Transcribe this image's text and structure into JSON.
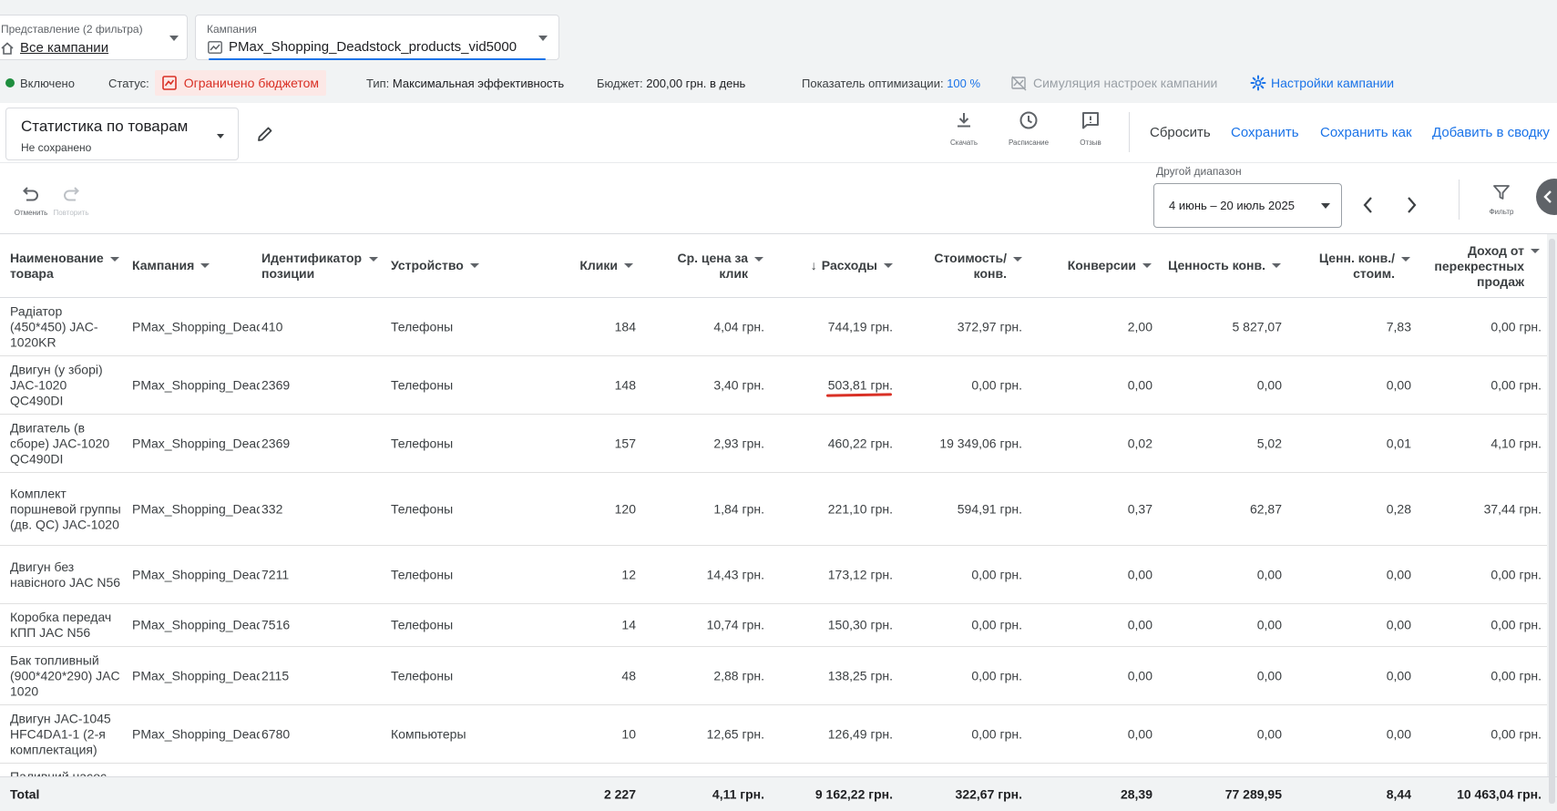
{
  "filters": {
    "view": {
      "label": "Представление (2 фильтра)",
      "value": "Все кампании",
      "icon": "home-icon"
    },
    "campaign": {
      "label": "Кампания",
      "value": "PMax_Shopping_Deadstock_products_vid5000",
      "icon": "trend-icon"
    }
  },
  "status_bar": {
    "enabled": "Включено",
    "status_label": "Статус:",
    "status_value": "Ограничено бюджетом",
    "type_label": "Тип:",
    "type_value": "Максимальная эффективность",
    "budget_label": "Бюджет:",
    "budget_value": "200,00 грн. в день",
    "optimization_label": "Показатель оптимизации:",
    "optimization_value": "100 %",
    "simulation": "Симуляция настроек кампании",
    "settings": "Настройки кампании"
  },
  "report": {
    "title": "Статистика по товарам",
    "subtitle": "Не сохранено"
  },
  "toolbar": {
    "download": "Скачать",
    "schedule": "Расписание",
    "feedback": "Отзыв",
    "reset": "Сбросить",
    "save": "Сохранить",
    "save_as": "Сохранить как",
    "add_to_summary": "Добавить в сводку"
  },
  "history": {
    "undo": "Отменить",
    "redo": "Повторить"
  },
  "date_range": {
    "label": "Другой диапазон",
    "value": "4 июнь – 20 июль 2025"
  },
  "filter_label": "Фильтр",
  "table": {
    "columns": {
      "name": "Наименование товара",
      "campaign": "Кампания",
      "item_id": "Идентификатор позиции",
      "device": "Устройство",
      "clicks": "Клики",
      "avg_cpc": "Ср. цена за клик",
      "cost": "Расходы",
      "cost_conv": "Стоимость/ конв.",
      "conversions": "Конверсии",
      "conv_value": "Ценность конв.",
      "value_cost": "Ценн. конв./ стоим.",
      "cross_sell": "Доход от перекрестных продаж"
    },
    "rows": [
      {
        "name": "Радіатор (450*450) JAC-1020KR",
        "campaign": "PMax_Shopping_Deadstock",
        "item_id": "410",
        "device": "Телефоны",
        "clicks": "184",
        "avg_cpc": "4,04 грн.",
        "cost": "744,19 грн.",
        "cost_conv": "372,97 грн.",
        "conversions": "2,00",
        "conv_value": "5 827,07",
        "value_cost": "7,83",
        "cross_sell": "0,00 грн."
      },
      {
        "name": "Двигун (у зборі) JAC-1020 QC490DI",
        "campaign": "PMax_Shopping_Deadstock",
        "item_id": "2369",
        "device": "Телефоны",
        "clicks": "148",
        "avg_cpc": "3,40 грн.",
        "cost": "503,81 грн.",
        "cost_conv": "0,00 грн.",
        "conversions": "0,00",
        "conv_value": "0,00",
        "value_cost": "0,00",
        "cross_sell": "0,00 грн."
      },
      {
        "name": "Двигатель (в сборе) JAC-1020 QC490DI",
        "campaign": "PMax_Shopping_Deadstock",
        "item_id": "2369",
        "device": "Телефоны",
        "clicks": "157",
        "avg_cpc": "2,93 грн.",
        "cost": "460,22 грн.",
        "cost_conv": "19 349,06 грн.",
        "conversions": "0,02",
        "conv_value": "5,02",
        "value_cost": "0,01",
        "cross_sell": "4,10 грн."
      },
      {
        "name": "Комплект поршневой группы (дв. QC) JAC-1020",
        "campaign": "PMax_Shopping_Deadstock",
        "item_id": "332",
        "device": "Телефоны",
        "clicks": "120",
        "avg_cpc": "1,84 грн.",
        "cost": "221,10 грн.",
        "cost_conv": "594,91 грн.",
        "conversions": "0,37",
        "conv_value": "62,87",
        "value_cost": "0,28",
        "cross_sell": "37,44 грн."
      },
      {
        "name": "Двигун без навісного JAC N56",
        "campaign": "PMax_Shopping_Deadstock",
        "item_id": "7211",
        "device": "Телефоны",
        "clicks": "12",
        "avg_cpc": "14,43 грн.",
        "cost": "173,12 грн.",
        "cost_conv": "0,00 грн.",
        "conversions": "0,00",
        "conv_value": "0,00",
        "value_cost": "0,00",
        "cross_sell": "0,00 грн."
      },
      {
        "name": "Коробка передач КПП JAC N56",
        "campaign": "PMax_Shopping_Deadstock",
        "item_id": "7516",
        "device": "Телефоны",
        "clicks": "14",
        "avg_cpc": "10,74 грн.",
        "cost": "150,30 грн.",
        "cost_conv": "0,00 грн.",
        "conversions": "0,00",
        "conv_value": "0,00",
        "value_cost": "0,00",
        "cross_sell": "0,00 грн."
      },
      {
        "name": "Бак топливный (900*420*290) JAC 1020",
        "campaign": "PMax_Shopping_Deadstock",
        "item_id": "2115",
        "device": "Телефоны",
        "clicks": "48",
        "avg_cpc": "2,88 грн.",
        "cost": "138,25 грн.",
        "cost_conv": "0,00 грн.",
        "conversions": "0,00",
        "conv_value": "0,00",
        "value_cost": "0,00",
        "cross_sell": "0,00 грн."
      },
      {
        "name": "Двигун JAC-1045 HFC4DA1-1 (2-я комплектация)",
        "campaign": "PMax_Shopping_Deadstock",
        "item_id": "6780",
        "device": "Компьютеры",
        "clicks": "10",
        "avg_cpc": "12,65 грн.",
        "cost": "126,49 грн.",
        "cost_conv": "0,00 грн.",
        "conversions": "0,00",
        "conv_value": "0,00",
        "value_cost": "0,00",
        "cross_sell": "0,00 грн."
      },
      {
        "name": "Паливний насос",
        "campaign": "",
        "item_id": "",
        "device": "",
        "clicks": "",
        "avg_cpc": "",
        "cost": "",
        "cost_conv": "",
        "conversions": "",
        "conv_value": "",
        "value_cost": "",
        "cross_sell": ""
      }
    ],
    "total": {
      "label": "Total",
      "clicks": "2 227",
      "avg_cpc": "4,11 грн.",
      "cost": "9 162,22 грн.",
      "cost_conv": "322,67 грн.",
      "conversions": "28,39",
      "conv_value": "77 289,95",
      "value_cost": "8,44",
      "cross_sell": "10 463,04 грн."
    }
  },
  "colors": {
    "accent": "#1a73e8",
    "warning": "#d93025",
    "enabled": "#1e8e3e"
  }
}
